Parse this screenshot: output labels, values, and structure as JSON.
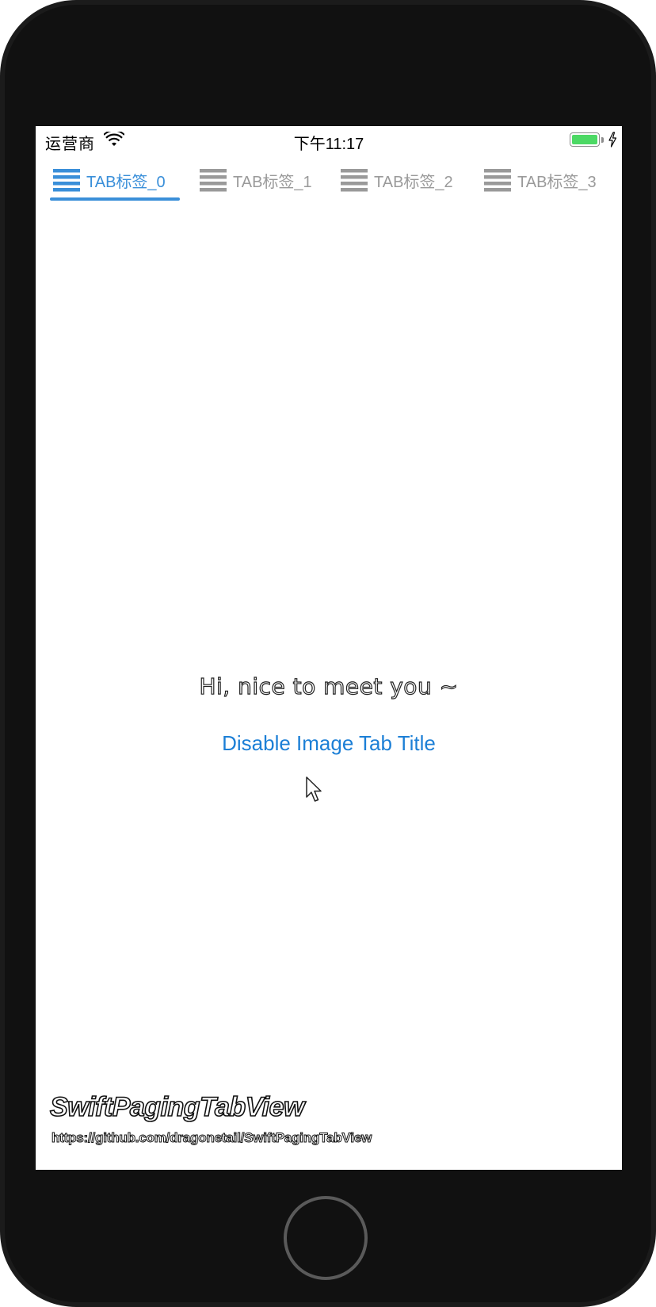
{
  "status_bar": {
    "carrier": "运营商",
    "time": "下午11:17",
    "battery_color": "#4cd964"
  },
  "tabs": [
    {
      "label": "TAB标签_0",
      "icon": "list-icon",
      "active": true
    },
    {
      "label": "TAB标签_1",
      "icon": "list-icon",
      "active": false
    },
    {
      "label": "TAB标签_2",
      "icon": "list-icon",
      "active": false
    },
    {
      "label": "TAB标签_3",
      "icon": "list-icon",
      "active": false
    }
  ],
  "content": {
    "greeting": "Hi, nice to meet you ~",
    "action_label": "Disable Image Tab Title"
  },
  "watermark": {
    "title": "SwiftPagingTabView",
    "url": "https://github.com/dragonetail/SwiftPagingTabView"
  },
  "colors": {
    "accent": "#3a8fd9",
    "inactive": "#9a9a9a",
    "link": "#1c7fd6"
  }
}
